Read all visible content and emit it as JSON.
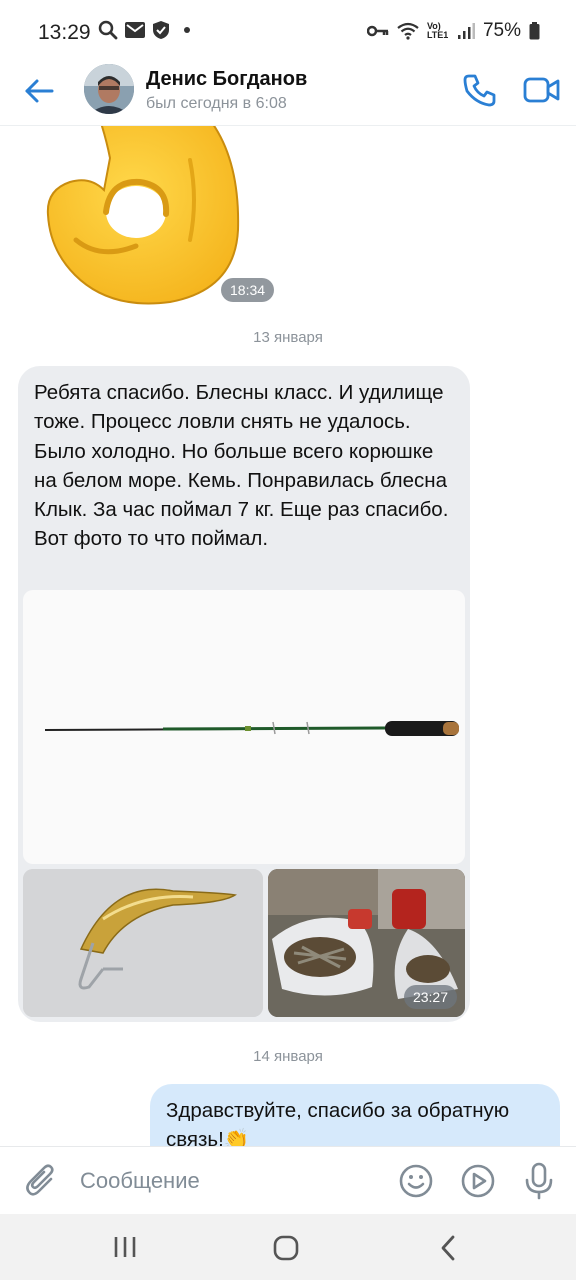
{
  "status_bar": {
    "time": "13:29",
    "battery": "75%",
    "network": "Vo) LTE1"
  },
  "header": {
    "contact_name": "Денис Богданов",
    "contact_status": "был сегодня в 6:08"
  },
  "chat": {
    "sticker_time": "18:34",
    "date_1": "13 января",
    "incoming_message": {
      "text": "Ребята спасибо. Блесны класс. И удилище тоже. Процесс ловли снять не удалось. Было холодно. Но больше всего корюшке на белом море. Кемь. Понравилась блесна Клык. За час поймал 7 кг. Еще раз спасибо. Вот фото то что поймал.",
      "photos_time": "23:27"
    },
    "date_2": "14 января",
    "outgoing_message": {
      "text": "Здравствуйте, спасибо за обратную связь!👏"
    }
  },
  "composer": {
    "placeholder": "Сообщение"
  },
  "colors": {
    "accent": "#2a7fd4",
    "incoming_bubble": "#ebedf0",
    "outgoing_bubble": "#d6e9fb"
  },
  "icons": [
    "search-icon",
    "mail-icon",
    "shield-icon",
    "key-icon",
    "wifi-icon",
    "signal-icon",
    "battery-icon",
    "back-arrow-icon",
    "phone-icon",
    "video-camera-icon",
    "paperclip-icon",
    "emoji-icon",
    "play-icon",
    "microphone-icon"
  ]
}
